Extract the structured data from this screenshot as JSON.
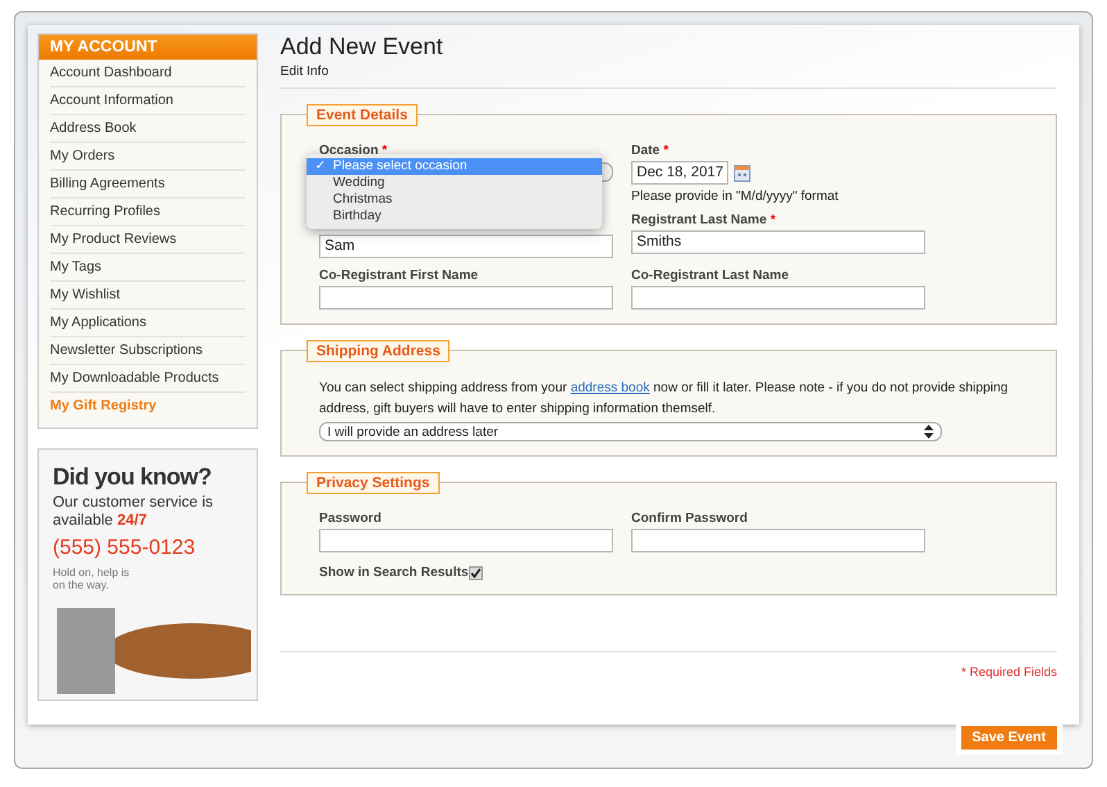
{
  "sidebar": {
    "title": "MY ACCOUNT",
    "items": [
      {
        "label": "Account Dashboard",
        "selected": false
      },
      {
        "label": "Account Information",
        "selected": false
      },
      {
        "label": "Address Book",
        "selected": false
      },
      {
        "label": "My Orders",
        "selected": false
      },
      {
        "label": "Billing Agreements",
        "selected": false
      },
      {
        "label": "Recurring Profiles",
        "selected": false
      },
      {
        "label": "My Product Reviews",
        "selected": false
      },
      {
        "label": "My Tags",
        "selected": false
      },
      {
        "label": "My Wishlist",
        "selected": false
      },
      {
        "label": "My Applications",
        "selected": false
      },
      {
        "label": "Newsletter Subscriptions",
        "selected": false
      },
      {
        "label": "My Downloadable Products",
        "selected": false
      },
      {
        "label": "My Gift Registry",
        "selected": true
      }
    ]
  },
  "ad": {
    "headline": "Did you know?",
    "text": "Our customer service is available",
    "highlight": "24/7",
    "phone": "(555) 555-0123",
    "note": "Hold on, help is on the way."
  },
  "page": {
    "title": "Add New Event",
    "subtitle": "Edit Info"
  },
  "event_details": {
    "legend": "Event Details",
    "occasion": {
      "label": "Occasion",
      "required_mark": "*",
      "options": [
        {
          "label": "Please select occasion",
          "selected": true
        },
        {
          "label": "Wedding",
          "selected": false
        },
        {
          "label": "Christmas",
          "selected": false
        },
        {
          "label": "Birthday",
          "selected": false
        }
      ],
      "check": "✓"
    },
    "date": {
      "label": "Date",
      "required_mark": "*",
      "value": "Dec 18, 2017",
      "hint": "Please provide in \"M/d/yyyy\" format"
    },
    "registrant_first": {
      "value": "Sam"
    },
    "registrant_last": {
      "label": "Registrant Last Name",
      "required_mark": "*",
      "value": "Smiths"
    },
    "co_first": {
      "label": "Co-Registrant First Name"
    },
    "co_last": {
      "label": "Co-Registrant Last Name"
    }
  },
  "shipping": {
    "legend": "Shipping Address",
    "text_before": "You can select shipping address from your",
    "link": "address book",
    "text_after": "now or fill it later. Please note - if you do not provide shipping address, gift buyers will have to enter shipping information themself.",
    "select_value": "I will provide an address later"
  },
  "privacy": {
    "legend": "Privacy Settings",
    "password_label": "Password",
    "confirm_label": "Confirm Password",
    "search_label": "Show in Search Results",
    "search_checked": true
  },
  "required_note": "* Required Fields",
  "save_button": "Save Event"
}
